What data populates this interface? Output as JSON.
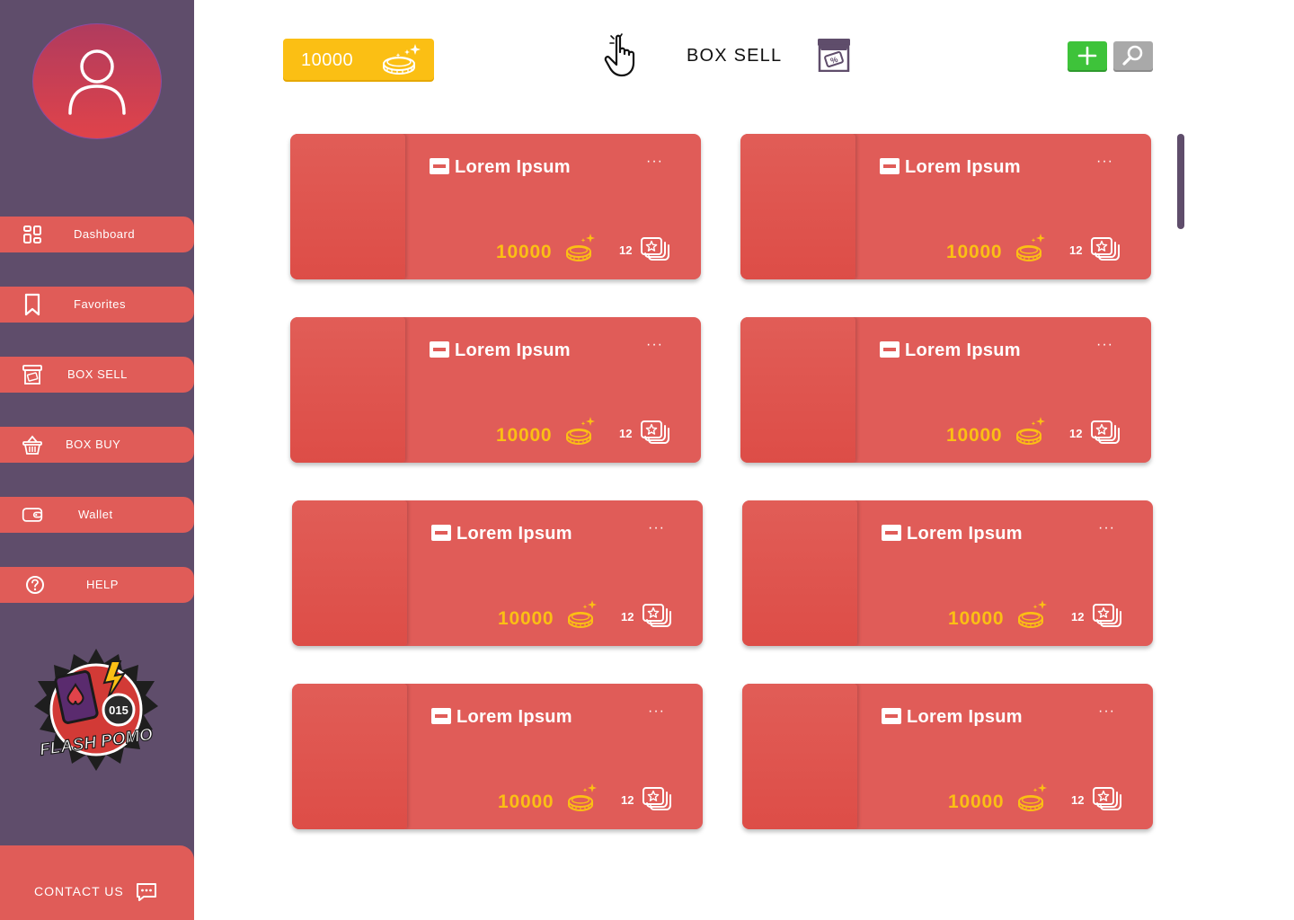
{
  "wallet": {
    "balance": "10000"
  },
  "header": {
    "title": "BOX SELL"
  },
  "sidebar": {
    "items": [
      {
        "label": "Dashboard",
        "icon": "dashboard-icon"
      },
      {
        "label": "Favorites",
        "icon": "bookmark-icon"
      },
      {
        "label": "BOX SELL",
        "icon": "store-icon"
      },
      {
        "label": "BOX BUY",
        "icon": "basket-icon"
      },
      {
        "label": "Wallet",
        "icon": "wallet-icon"
      },
      {
        "label": "HELP",
        "icon": "help-icon"
      }
    ],
    "logo_text": {
      "line1": "FLASH POMO",
      "badge": "015"
    },
    "contact_label": "CONTACT US"
  },
  "cards": [
    {
      "title": "Lorem Ipsum",
      "price": "10000",
      "qty": "12"
    },
    {
      "title": "Lorem Ipsum",
      "price": "10000",
      "qty": "12"
    },
    {
      "title": "Lorem Ipsum",
      "price": "10000",
      "qty": "12"
    },
    {
      "title": "Lorem Ipsum",
      "price": "10000",
      "qty": "12"
    },
    {
      "title": "Lorem Ipsum",
      "price": "10000",
      "qty": "12"
    },
    {
      "title": "Lorem Ipsum",
      "price": "10000",
      "qty": "12"
    },
    {
      "title": "Lorem Ipsum",
      "price": "10000",
      "qty": "12"
    },
    {
      "title": "Lorem Ipsum",
      "price": "10000",
      "qty": "12"
    }
  ],
  "card_more_label": "···",
  "colors": {
    "sidebar": "#5f4d6b",
    "accent": "#e05c58",
    "coin": "#fbbf14",
    "add": "#3ec33a",
    "search": "#a9a9a9"
  }
}
